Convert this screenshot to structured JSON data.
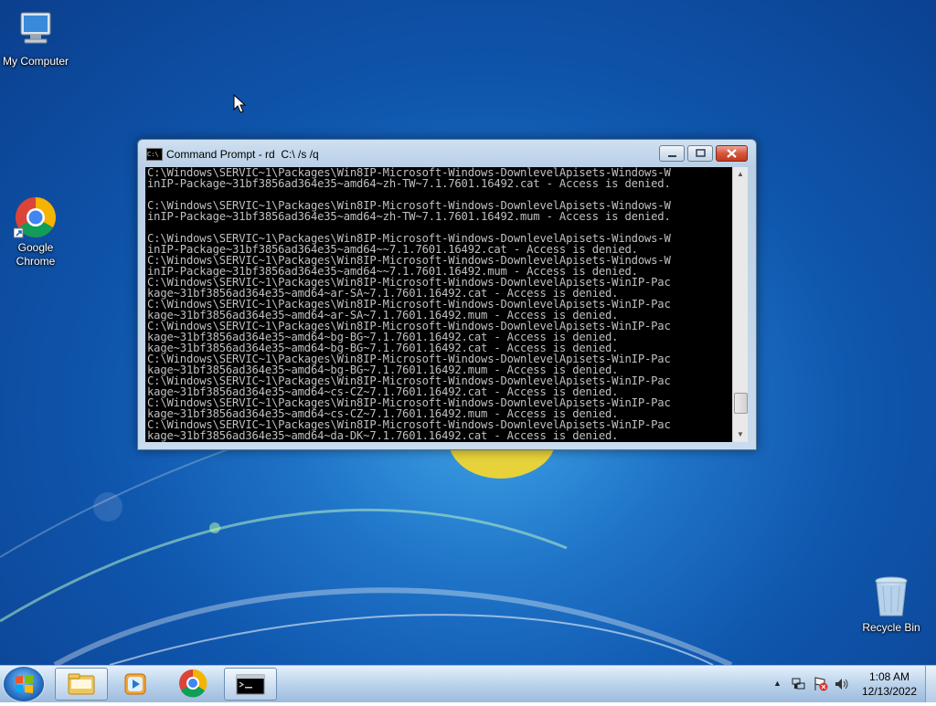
{
  "desktop": {
    "icons": [
      {
        "label": "My Computer"
      },
      {
        "label": "Google Chrome"
      },
      {
        "label": "Recycle Bin"
      }
    ]
  },
  "window": {
    "title": "Command Prompt - rd  C:\\ /s /q",
    "console_lines": [
      "C:\\Windows\\SERVIC~1\\Packages\\Win8IP-Microsoft-Windows-DownlevelApisets-Windows-W",
      "inIP-Package~31bf3856ad364e35~amd64~zh-TW~7.1.7601.16492.cat - Access is denied.",
      "",
      "C:\\Windows\\SERVIC~1\\Packages\\Win8IP-Microsoft-Windows-DownlevelApisets-Windows-W",
      "inIP-Package~31bf3856ad364e35~amd64~zh-TW~7.1.7601.16492.mum - Access is denied.",
      "",
      "C:\\Windows\\SERVIC~1\\Packages\\Win8IP-Microsoft-Windows-DownlevelApisets-Windows-W",
      "inIP-Package~31bf3856ad364e35~amd64~~7.1.7601.16492.cat - Access is denied.",
      "C:\\Windows\\SERVIC~1\\Packages\\Win8IP-Microsoft-Windows-DownlevelApisets-Windows-W",
      "inIP-Package~31bf3856ad364e35~amd64~~7.1.7601.16492.mum - Access is denied.",
      "C:\\Windows\\SERVIC~1\\Packages\\Win8IP-Microsoft-Windows-DownlevelApisets-WinIP-Pac",
      "kage~31bf3856ad364e35~amd64~ar-SA~7.1.7601.16492.cat - Access is denied.",
      "C:\\Windows\\SERVIC~1\\Packages\\Win8IP-Microsoft-Windows-DownlevelApisets-WinIP-Pac",
      "kage~31bf3856ad364e35~amd64~ar-SA~7.1.7601.16492.mum - Access is denied.",
      "C:\\Windows\\SERVIC~1\\Packages\\Win8IP-Microsoft-Windows-DownlevelApisets-WinIP-Pac",
      "kage~31bf3856ad364e35~amd64~bg-BG~7.1.7601.16492.cat - Access is denied.",
      "kage~31bf3856ad364e35~amd64~bg-BG~7.1.7601.16492.cat - Access is denied.",
      "C:\\Windows\\SERVIC~1\\Packages\\Win8IP-Microsoft-Windows-DownlevelApisets-WinIP-Pac",
      "kage~31bf3856ad364e35~amd64~bg-BG~7.1.7601.16492.mum - Access is denied.",
      "C:\\Windows\\SERVIC~1\\Packages\\Win8IP-Microsoft-Windows-DownlevelApisets-WinIP-Pac",
      "kage~31bf3856ad364e35~amd64~cs-CZ~7.1.7601.16492.cat - Access is denied.",
      "C:\\Windows\\SERVIC~1\\Packages\\Win8IP-Microsoft-Windows-DownlevelApisets-WinIP-Pac",
      "kage~31bf3856ad364e35~amd64~cs-CZ~7.1.7601.16492.mum - Access is denied.",
      "C:\\Windows\\SERVIC~1\\Packages\\Win8IP-Microsoft-Windows-DownlevelApisets-WinIP-Pac",
      "kage~31bf3856ad364e35~amd64~da-DK~7.1.7601.16492.cat - Access is denied."
    ],
    "scroll_position": 0.93
  },
  "taskbar": {
    "pinned": [
      {
        "icon": "windows-explorer-icon"
      },
      {
        "icon": "windows-media-player-icon"
      },
      {
        "icon": "chrome-icon"
      },
      {
        "icon": "command-prompt-icon"
      }
    ],
    "tray_icons": [
      "show-hidden-icons",
      "network-icon",
      "action-center-flag-icon",
      "volume-icon"
    ],
    "clock": {
      "time": "1:08 AM",
      "date": "12/13/2022"
    }
  },
  "colors": {
    "desktop_blue": "#1f74c8",
    "console_bg": "#000000",
    "console_text": "#c0c0c0",
    "close_red": "#c13a1d"
  }
}
